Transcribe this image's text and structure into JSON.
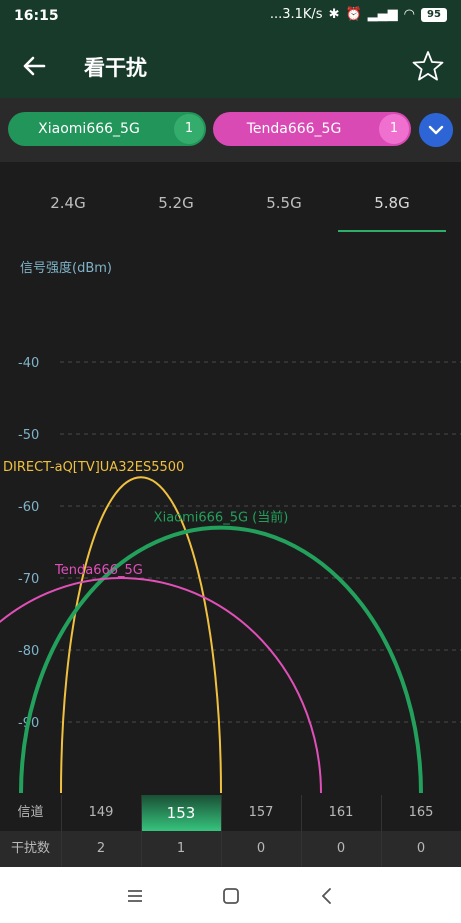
{
  "status": {
    "time": "16:15",
    "net_speed": "...3.1K/s",
    "battery": "95"
  },
  "appbar": {
    "title": "看干扰"
  },
  "chips": [
    {
      "label": "Xiaomi666_5G",
      "count": "1",
      "color": "#22955a"
    },
    {
      "label": "Tenda666_5G",
      "count": "1",
      "color": "#d94ab5"
    }
  ],
  "tabs": [
    "2.4G",
    "5.2G",
    "5.5G",
    "5.8G"
  ],
  "active_tab": "5.8G",
  "chart_data": {
    "type": "area",
    "ylabel": "信号强度(dBm)",
    "y_ticks": [
      -40,
      -50,
      -60,
      -70,
      -80,
      -90
    ],
    "ylim": [
      -100,
      -30
    ],
    "x_categories": [
      "149",
      "153",
      "157",
      "161",
      "165"
    ],
    "series": [
      {
        "name": "DIRECT-aQ[TV]UA32ES5500",
        "center_channel": 151,
        "span_channels": 8,
        "peak_dbm": -56,
        "color": "#f0c040"
      },
      {
        "name": "Xiaomi666_5G (当前)",
        "center_channel": 155,
        "span_channels": 20,
        "peak_dbm": -63,
        "color": "#22a05c"
      },
      {
        "name": "Tenda666_5G",
        "center_channel": 150,
        "span_channels": 20,
        "peak_dbm": -70,
        "color": "#e050b8"
      }
    ]
  },
  "table": {
    "channel_label": "信道",
    "interference_label": "干扰数",
    "channels": [
      "149",
      "153",
      "157",
      "161",
      "165"
    ],
    "counts": [
      "2",
      "1",
      "0",
      "0",
      "0"
    ],
    "highlight": "153"
  }
}
